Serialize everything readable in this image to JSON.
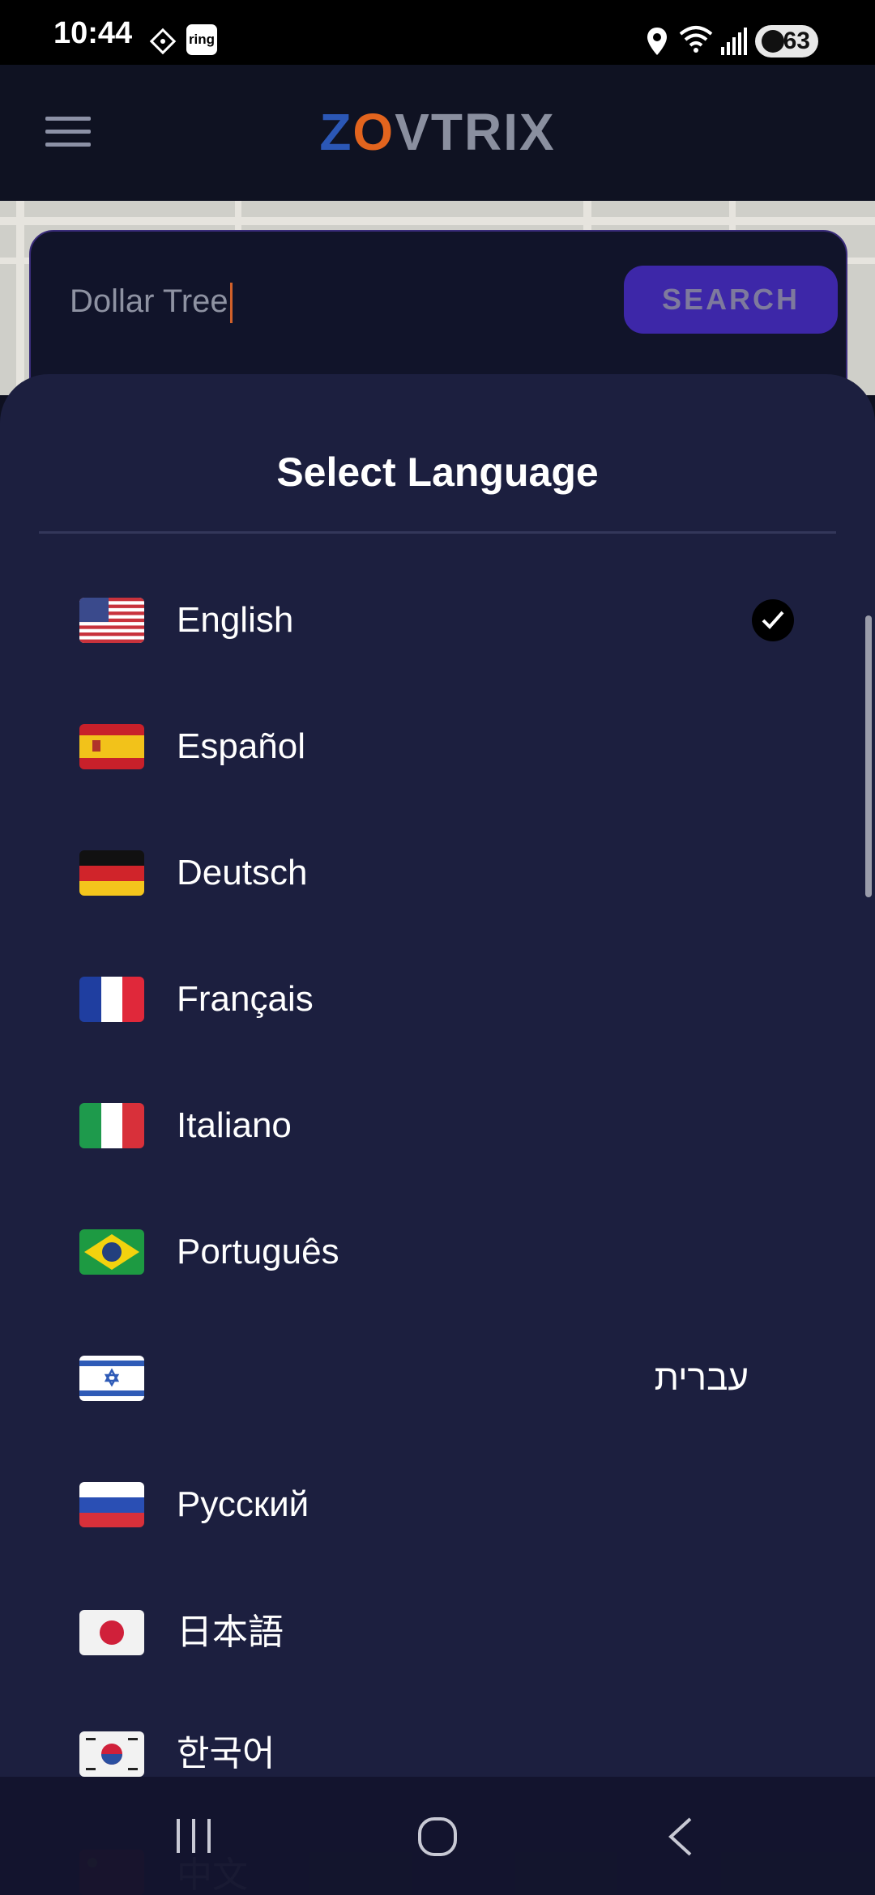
{
  "status_bar": {
    "time": "10:44",
    "ring_label": "ring",
    "battery": "63",
    "icons": [
      "diamond-notification-icon",
      "ring-app-icon",
      "location-icon",
      "wifi-icon",
      "signal-icon",
      "battery-icon"
    ]
  },
  "header": {
    "logo": {
      "z": "Z",
      "o": "O",
      "rest": "VTRIX"
    },
    "menu_icon": "hamburger-menu-icon"
  },
  "search": {
    "value": "Dollar Tree",
    "button_label": "SEARCH"
  },
  "language_sheet": {
    "title": "Select Language",
    "selected": "English",
    "items": [
      {
        "label": "English",
        "flag": "us-flag-icon"
      },
      {
        "label": "Español",
        "flag": "spain-flag-icon"
      },
      {
        "label": "Deutsch",
        "flag": "germany-flag-icon"
      },
      {
        "label": "Français",
        "flag": "france-flag-icon"
      },
      {
        "label": "Italiano",
        "flag": "italy-flag-icon"
      },
      {
        "label": "Português",
        "flag": "brazil-flag-icon"
      },
      {
        "label": "עברית",
        "flag": "israel-flag-icon"
      },
      {
        "label": "Русский",
        "flag": "russia-flag-icon"
      },
      {
        "label": "日本語",
        "flag": "japan-flag-icon"
      },
      {
        "label": "한국어",
        "flag": "korea-flag-icon"
      },
      {
        "label": "中文",
        "flag": "china-flag-icon"
      }
    ]
  },
  "nav_bar": {
    "icons": [
      "recent-apps-icon",
      "home-icon",
      "back-icon"
    ]
  },
  "colors": {
    "sheet_bg": "#1c1f3f",
    "accent": "#3d27a8",
    "logo_blue": "#2b57b6",
    "logo_orange": "#e2641e"
  }
}
